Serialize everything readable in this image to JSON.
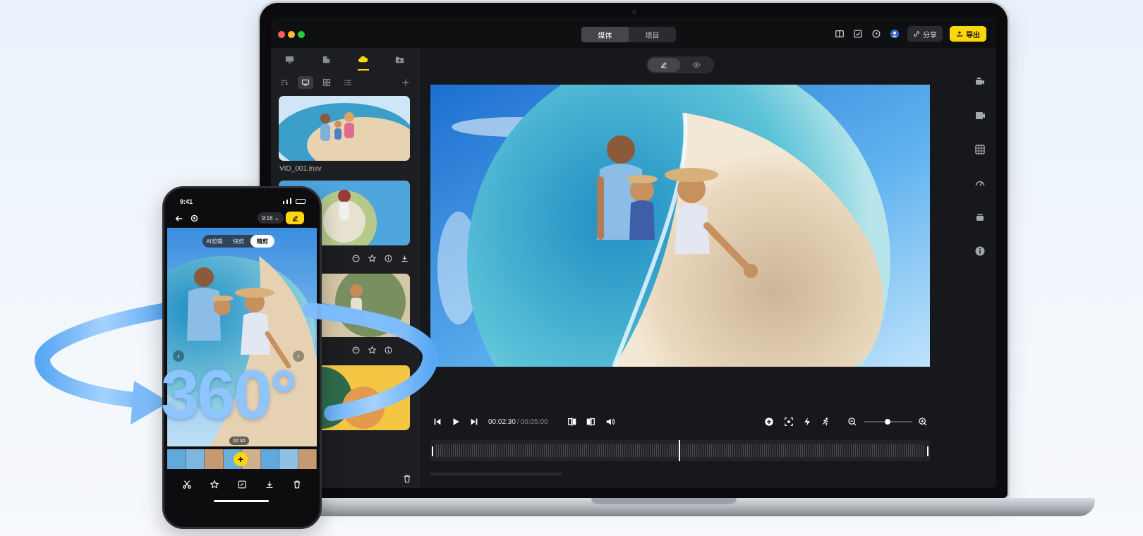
{
  "laptop": {
    "titlebar": {
      "segments": [
        {
          "label": "媒体",
          "active": true
        },
        {
          "label": "项目",
          "active": false
        }
      ],
      "share_label": "分享",
      "export_label": "导出",
      "icons": [
        "book-icon",
        "note-icon",
        "timer-icon",
        "avatar-icon"
      ]
    },
    "sidebar": {
      "tabs": [
        "monitor-icon",
        "file-icon",
        "cloud-icon",
        "folder-add-icon"
      ],
      "active_tab": 2,
      "tools": [
        "sort-icon",
        "screen-view-icon",
        "grid-view-icon",
        "list-view-icon",
        "add-icon"
      ],
      "items": [
        {
          "label": "VID_001.insv"
        },
        {
          "label": ""
        },
        {
          "label": ""
        },
        {
          "label": ""
        }
      ]
    },
    "player": {
      "current_time": "00:02:30",
      "separator": "/",
      "duration": "00:05:00",
      "zoom_level": 0.5
    },
    "right_tools": [
      "camera-icon",
      "clip-icon",
      "grid-icon",
      "speed-icon",
      "stack-icon",
      "info-icon"
    ]
  },
  "phone": {
    "status_time": "9:41",
    "ratio_label": "9:16 ⌄",
    "modes": [
      {
        "label": "AI剪辑",
        "active": false
      },
      {
        "label": "快剪",
        "active": false
      },
      {
        "label": "精剪",
        "active": true
      }
    ],
    "timecode": "02:30",
    "toolbar": [
      "cut-icon",
      "star-icon",
      "edit-icon",
      "download-icon",
      "trash-icon"
    ]
  },
  "overlay": {
    "big_text": "360°"
  },
  "colors": {
    "accent": "#ffd60a",
    "panel": "#1d1e21",
    "ring": "#8ec5ff"
  }
}
